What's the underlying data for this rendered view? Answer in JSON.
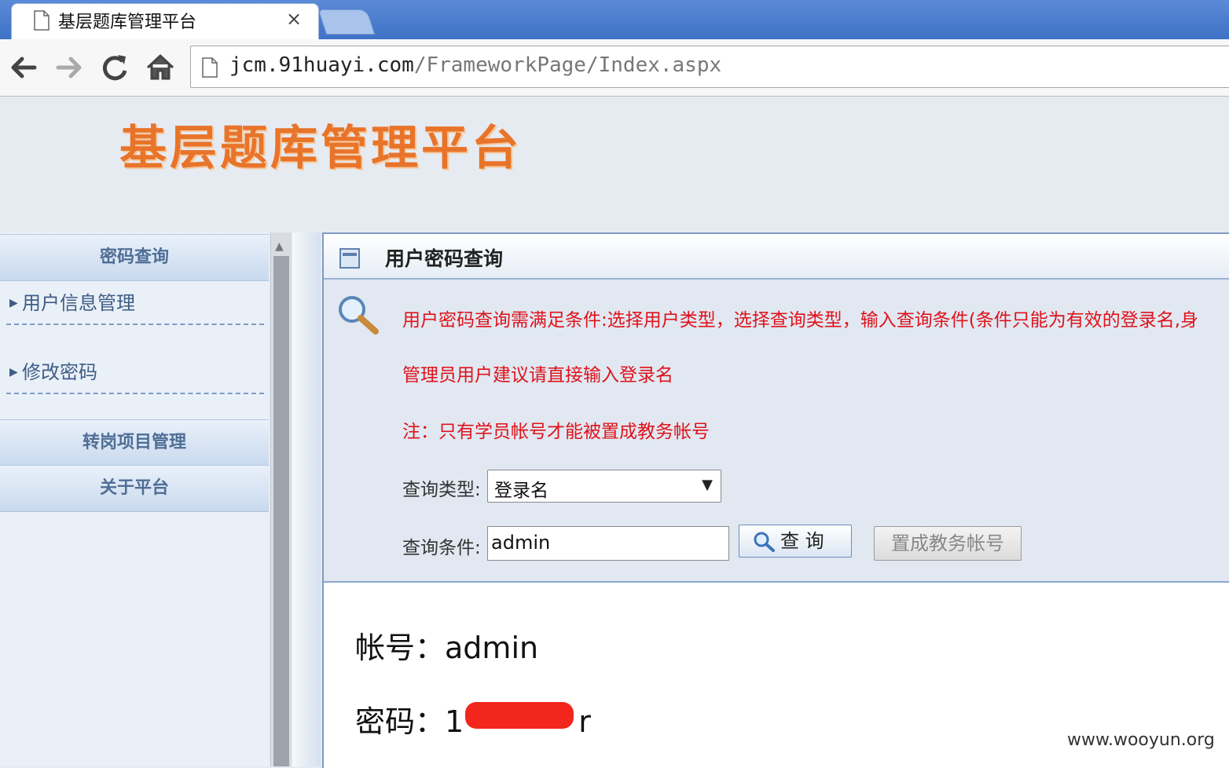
{
  "browser": {
    "tab_title": "基层题库管理平台",
    "tab_close": "×",
    "url_host": "jcm.91huayi.com",
    "url_path": "/FrameworkPage/Index.aspx"
  },
  "header": {
    "logo_text": "基层题库管理平台"
  },
  "sidebar": {
    "section1": "密码查询",
    "items": [
      {
        "label": "用户信息管理"
      },
      {
        "label": "修改密码"
      }
    ],
    "section2": "转岗项目管理",
    "section3": "关于平台"
  },
  "panel": {
    "title": "用户密码查询",
    "notice1": "用户密码查询需满足条件:选择用户类型，选择查询类型，输入查询条件(条件只能为有效的登录名,身",
    "notice2": "管理员用户建议请直接输入登录名",
    "notice3": "注：只有学员帐号才能被置成教务帐号",
    "query_type_label": "查询类型:",
    "query_type_value": "登录名",
    "query_cond_label": "查询条件:",
    "query_cond_value": "admin",
    "query_button": "查 询",
    "set_button": "置成教务帐号"
  },
  "result": {
    "account_label": "帐号：",
    "account_value": "admin",
    "password_label": "密码：",
    "password_start": "1",
    "password_end": "r"
  },
  "watermark": "www.wooyun.org"
}
